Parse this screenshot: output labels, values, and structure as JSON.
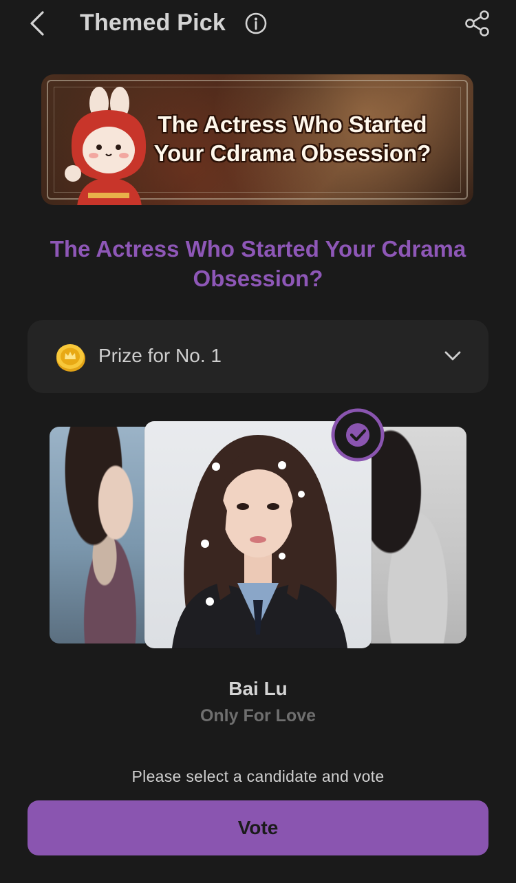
{
  "header": {
    "title": "Themed Pick"
  },
  "banner": {
    "text": "The Actress Who Started Your Cdrama Obsession?"
  },
  "topic": {
    "title": "The Actress Who Started Your Cdrama Obsession?"
  },
  "prize": {
    "label": "Prize for No. 1"
  },
  "candidate": {
    "name": "Bai Lu",
    "drama": "Only For Love"
  },
  "hint": "Please select a candidate and vote",
  "vote_button": {
    "label": "Vote"
  },
  "colors": {
    "accent": "#8a55b0",
    "topic_text": "#8e57b7",
    "background": "#1a1a1a"
  }
}
